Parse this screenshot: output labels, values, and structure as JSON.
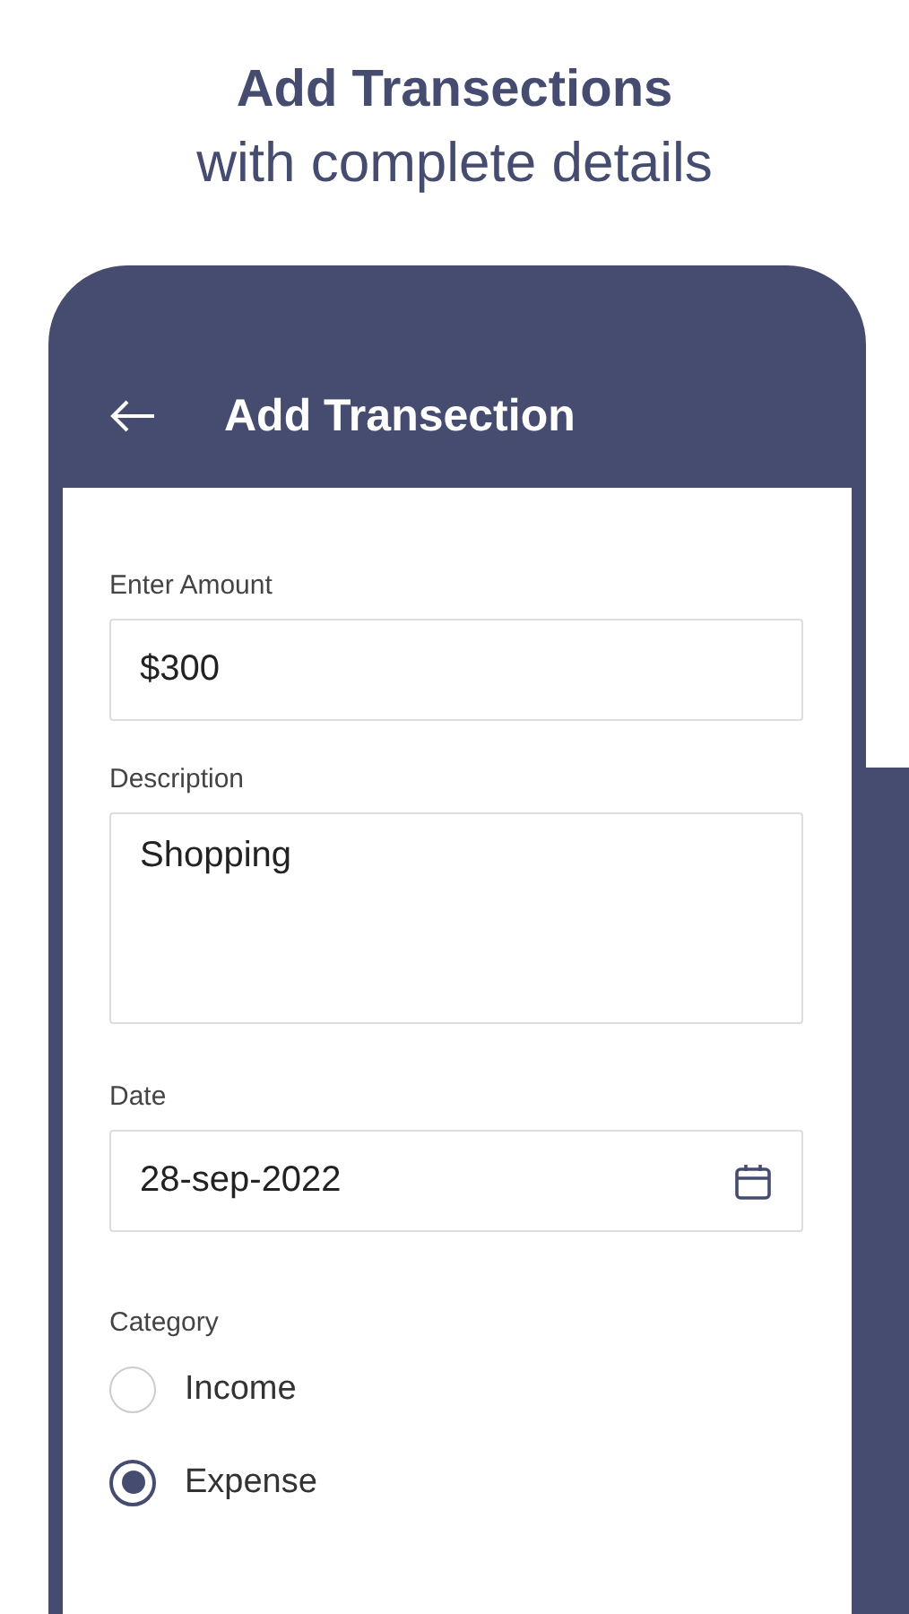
{
  "headline": {
    "title": "Add Transections",
    "subtitle": "with complete details"
  },
  "app_bar": {
    "title": "Add Transection"
  },
  "fields": [
    {
      "kind": "input",
      "label": "Enter Amount",
      "value": "$300"
    },
    {
      "kind": "textarea",
      "label": "Description",
      "value": "Shopping"
    },
    {
      "kind": "date",
      "label": "Date",
      "value": "28-sep-2022"
    }
  ],
  "category": {
    "label": "Category",
    "options": [
      {
        "label": "Income",
        "selected": false
      },
      {
        "label": "Expense",
        "selected": true
      }
    ]
  }
}
